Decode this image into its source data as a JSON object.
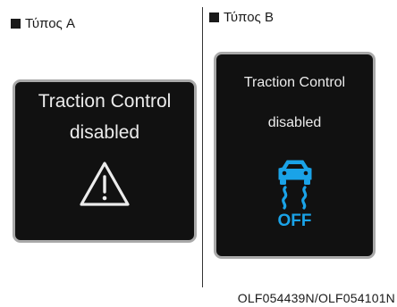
{
  "panel_a": {
    "label": "Τύπος A",
    "message_line1": "Traction Control",
    "message_line2": "disabled",
    "icon": "warning-triangle-icon"
  },
  "panel_b": {
    "label": "Τύπος B",
    "message_line1": "Traction Control",
    "message_line2": "disabled",
    "icon": "traction-control-off-icon",
    "icon_text": "OFF",
    "icon_color": "#1aa3e8"
  },
  "image_code": "OLF054439N/OLF054101N",
  "colors": {
    "display_bg": "#111111",
    "display_border": "#a9a9a9",
    "display_text": "#ececec"
  }
}
